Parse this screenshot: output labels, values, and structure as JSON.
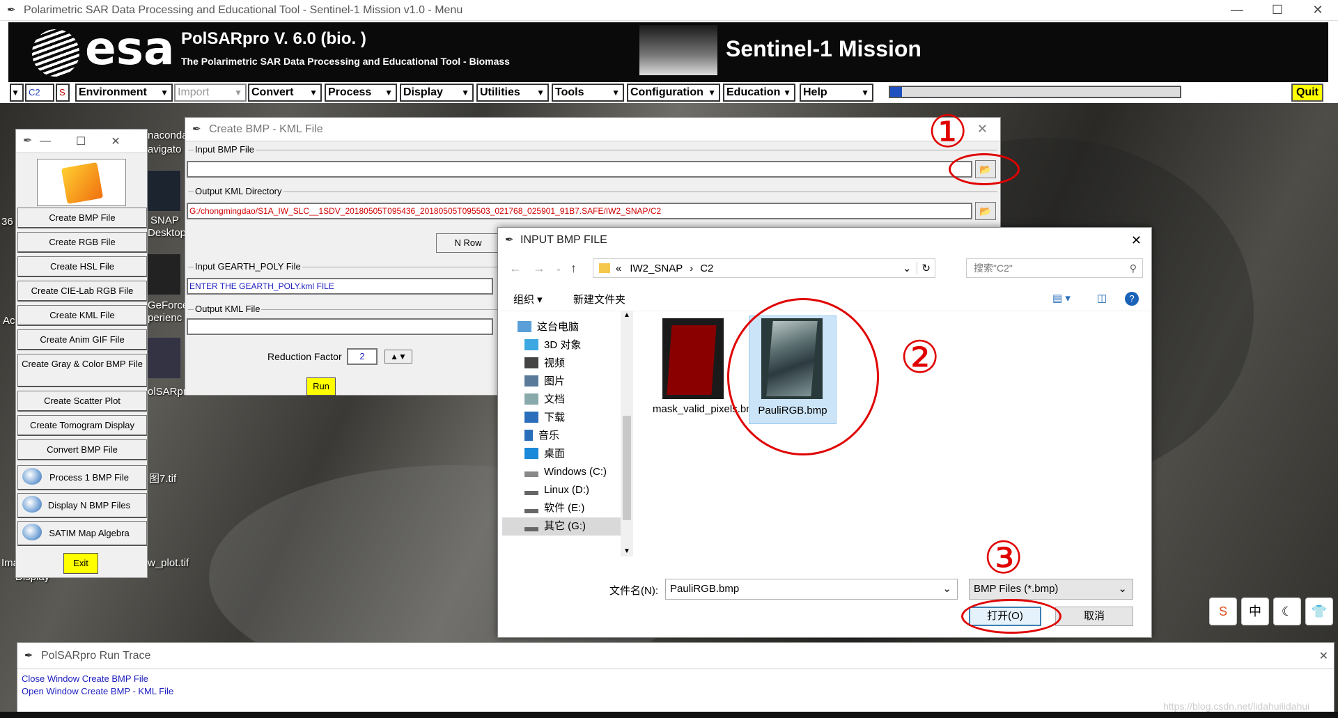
{
  "main_window": {
    "title": "Polarimetric SAR Data Processing and Educational Tool - Sentinel-1 Mission v1.0 - Menu",
    "controls": [
      "—",
      "☐",
      "✕"
    ]
  },
  "banner": {
    "esa_text": "esa",
    "polsar_title": "PolSARpro V. 6.0 (bio. )",
    "polsar_subtitle": "The Polarimetric SAR Data Processing and Educational Tool - Biomass",
    "mission_title": "Sentinel-1 Mission"
  },
  "menubar": {
    "mode_selector": "C2",
    "mode_s": "S",
    "items": [
      "Environment",
      "Import",
      "Convert",
      "Process",
      "Display",
      "Utilities",
      "Tools",
      "Configuration",
      "Education",
      "Help"
    ],
    "progress": 0.01,
    "quit": "Quit"
  },
  "side_panel": {
    "buttons": [
      "Create BMP File",
      "Create RGB File",
      "Create HSL File",
      "Create CIE-Lab RGB File",
      "Create KML File",
      "Create Anim GIF File",
      "Create Gray & Color BMP File",
      "Create Scatter Plot",
      "Create Tomogram Display",
      "Convert BMP File",
      "Process 1 BMP File",
      "Display N BMP Files",
      "SATIM Map Algebra"
    ],
    "exit": "Exit"
  },
  "desktop_icons": [
    "naconda",
    "avigato",
    "SNAP",
    "Desktop",
    "GeForce",
    "perienc",
    "olSARpr",
    "图7.tif",
    "w_plot.tif",
    "36",
    "Ac",
    "Ima",
    "Display"
  ],
  "kml_window": {
    "title": "Create BMP - KML File",
    "input_bmp_label": "Input BMP File",
    "input_bmp_value": "",
    "output_kml_dir_label": "Output KML Directory",
    "output_kml_dir_value": "G:/chongmingdao/S1A_IW_SLC__1SDV_20180505T095436_20180505T095503_021768_025901_91B7.SAFE/IW2_SNAP/C2",
    "nrow_label": "N Row",
    "gearth_label": "Input GEARTH_POLY File",
    "gearth_value": "ENTER THE GEARTH_POLY.kml FILE",
    "output_kml_label": "Output KML File",
    "output_kml_value": "",
    "reduction_label": "Reduction Factor",
    "reduction_value": "2",
    "run": "Run"
  },
  "file_dialog": {
    "title": "INPUT BMP FILE",
    "breadcrumb": [
      "«",
      "IW2_SNAP",
      "›",
      "C2"
    ],
    "search_placeholder": "搜索\"C2\"",
    "organize": "组织 ▾",
    "new_folder": "新建文件夹",
    "nav_items": [
      "这台电脑",
      "3D 对象",
      "视频",
      "图片",
      "文档",
      "下载",
      "音乐",
      "桌面",
      "Windows (C:)",
      "Linux (D:)",
      "软件 (E:)",
      "其它 (G:)"
    ],
    "files": [
      {
        "name": "mask_valid_pixels.bmp",
        "selected": false
      },
      {
        "name": "PauliRGB.bmp",
        "selected": true
      }
    ],
    "filename_label": "文件名(N):",
    "filename_value": "PauliRGB.bmp",
    "filetype_value": "BMP Files (*.bmp)",
    "open": "打开(O)",
    "cancel": "取消"
  },
  "annotations": [
    "①",
    "②",
    "③"
  ],
  "trace": {
    "title": "PolSARpro Run Trace",
    "lines": [
      "Close Window Create BMP File",
      "Open Window Create BMP - KML File"
    ]
  },
  "ime": [
    "S",
    "中",
    "☾",
    "👕"
  ],
  "watermark": "https://blog.csdn.net/lidahuilidahui"
}
